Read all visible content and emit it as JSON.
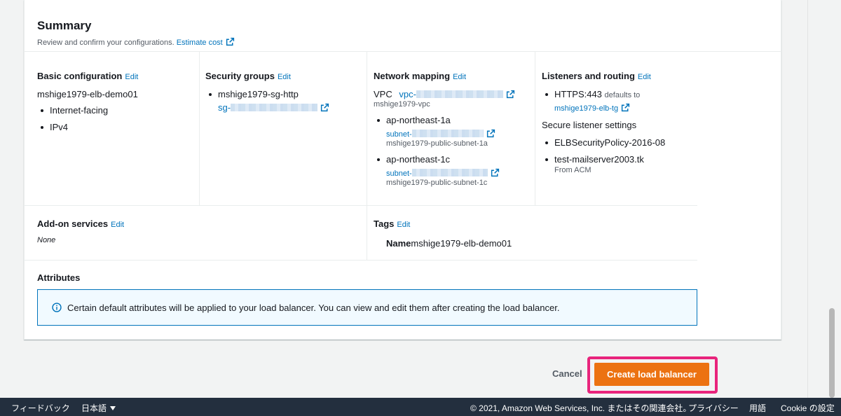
{
  "summary": {
    "title": "Summary",
    "description": "Review and confirm your configurations.",
    "estimate_cost": "Estimate cost"
  },
  "edit_label": "Edit",
  "basic_config": {
    "title": "Basic configuration",
    "name": "mshige1979-elb-demo01",
    "items": [
      "Internet-facing",
      "IPv4"
    ]
  },
  "security_groups": {
    "title": "Security groups",
    "group_name": "mshige1979-sg-http",
    "group_id_prefix": "sg-"
  },
  "network_mapping": {
    "title": "Network mapping",
    "vpc_label": "VPC",
    "vpc_id_prefix": "vpc-",
    "vpc_name": "mshige1979-vpc",
    "zones": [
      {
        "az": "ap-northeast-1a",
        "subnet_prefix": "subnet-",
        "subnet_name": "mshige1979-public-subnet-1a"
      },
      {
        "az": "ap-northeast-1c",
        "subnet_prefix": "subnet-",
        "subnet_name": "mshige1979-public-subnet-1c"
      }
    ]
  },
  "listeners": {
    "title": "Listeners and routing",
    "listener": "HTTPS:443",
    "defaults_to": "defaults to",
    "target_group": "mshige1979-elb-tg",
    "secure_title": "Secure listener settings",
    "policy": "ELBSecurityPolicy-2016-08",
    "certificate": "test-mailserver2003.tk",
    "cert_source": "From ACM"
  },
  "addons": {
    "title": "Add-on services",
    "value": "None"
  },
  "tags": {
    "title": "Tags",
    "key": "Name",
    "value": "mshige1979-elb-demo01"
  },
  "attributes": {
    "title": "Attributes",
    "info": "Certain default attributes will be applied to your load balancer. You can view and edit them after creating the load balancer."
  },
  "actions": {
    "cancel": "Cancel",
    "create": "Create load balancer"
  },
  "footer": {
    "feedback": "フィードバック",
    "language": "日本語",
    "copyright": "© 2021, Amazon Web Services, Inc. またはその関連会社。",
    "privacy": "プライバシー",
    "terms": "用語",
    "cookie": "Cookie の設定"
  },
  "colors": {
    "primary": "#ec7211",
    "link": "#0073bb",
    "highlight": "#e8247c",
    "footer_bg": "#232f3e"
  },
  "icons": [
    "external-link-icon",
    "info-icon",
    "caret-down-icon"
  ]
}
